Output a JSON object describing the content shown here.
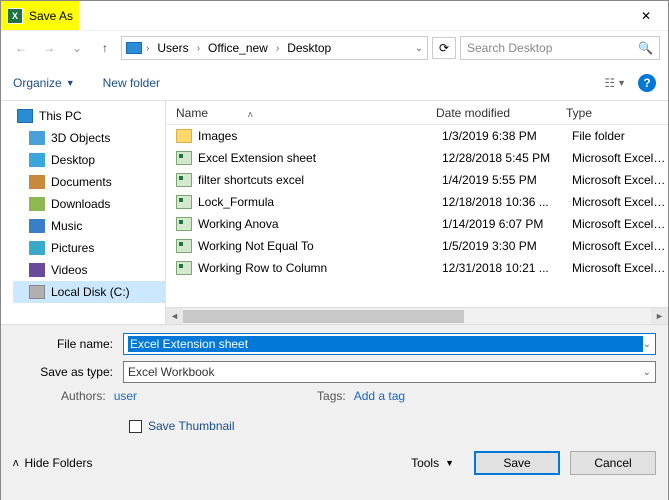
{
  "title": "Save As",
  "breadcrumbs": [
    "Users",
    "Office_new",
    "Desktop"
  ],
  "search_placeholder": "Search Desktop",
  "toolbar": {
    "organize": "Organize",
    "new_folder": "New folder"
  },
  "sidebar": {
    "root": "This PC",
    "items": [
      {
        "label": "3D Objects"
      },
      {
        "label": "Desktop"
      },
      {
        "label": "Documents"
      },
      {
        "label": "Downloads"
      },
      {
        "label": "Music"
      },
      {
        "label": "Pictures"
      },
      {
        "label": "Videos"
      },
      {
        "label": "Local Disk (C:)"
      }
    ]
  },
  "columns": {
    "name": "Name",
    "date": "Date modified",
    "type": "Type"
  },
  "files": [
    {
      "icon": "folder",
      "name": "Images",
      "date": "1/3/2019 6:38 PM",
      "type": "File folder"
    },
    {
      "icon": "xls",
      "name": "Excel Extension sheet",
      "date": "12/28/2018 5:45 PM",
      "type": "Microsoft Excel W..."
    },
    {
      "icon": "xls",
      "name": "filter shortcuts excel",
      "date": "1/4/2019 5:55 PM",
      "type": "Microsoft Excel W..."
    },
    {
      "icon": "xls",
      "name": "Lock_Formula",
      "date": "12/18/2018 10:36 ...",
      "type": "Microsoft Excel W..."
    },
    {
      "icon": "xls",
      "name": "Working Anova",
      "date": "1/14/2019 6:07 PM",
      "type": "Microsoft Excel W..."
    },
    {
      "icon": "xls",
      "name": "Working Not Equal To",
      "date": "1/5/2019 3:30 PM",
      "type": "Microsoft Excel W..."
    },
    {
      "icon": "xls",
      "name": "Working Row to Column",
      "date": "12/31/2018 10:21 ...",
      "type": "Microsoft Excel W..."
    }
  ],
  "form": {
    "filename_label": "File name:",
    "filename_value": "Excel Extension sheet",
    "type_label": "Save as type:",
    "type_value": "Excel Workbook",
    "authors_label": "Authors:",
    "authors_value": "user",
    "tags_label": "Tags:",
    "tags_value": "Add a tag",
    "thumb_label": "Save Thumbnail",
    "hide_folders": "Hide Folders",
    "tools": "Tools",
    "save": "Save",
    "cancel": "Cancel"
  }
}
